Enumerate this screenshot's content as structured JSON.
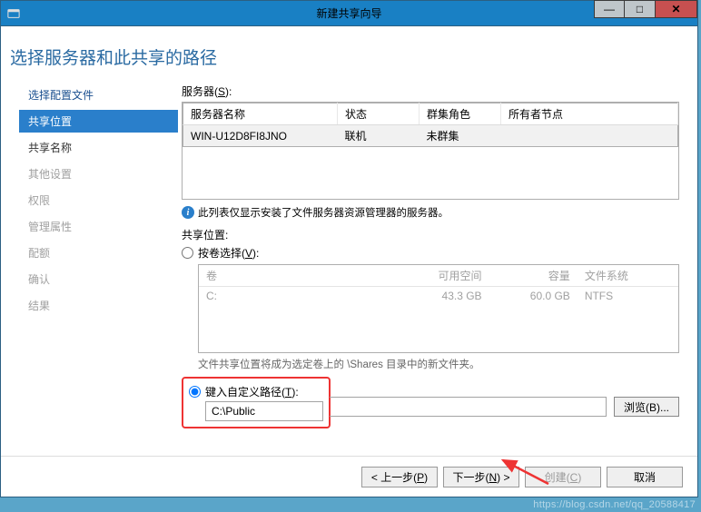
{
  "titlebar": {
    "title": "新建共享向导"
  },
  "page": {
    "heading": "选择服务器和此共享的路径"
  },
  "steps": {
    "s0": "选择配置文件",
    "s1": "共享位置",
    "s2": "共享名称",
    "s3": "其他设置",
    "s4": "权限",
    "s5": "管理属性",
    "s6": "配额",
    "s7": "确认",
    "s8": "结果"
  },
  "server": {
    "label": "服务器(S):",
    "headers": {
      "name": "服务器名称",
      "status": "状态",
      "role": "群集角色",
      "owner": "所有者节点"
    },
    "row": {
      "name": "WIN-U12D8FI8JNO",
      "status": "联机",
      "role": "未群集",
      "owner": ""
    },
    "info": "此列表仅显示安装了文件服务器资源管理器的服务器。"
  },
  "location": {
    "label": "共享位置:",
    "byVolume": "按卷选择(V):",
    "volHeaders": {
      "vol": "卷",
      "free": "可用空间",
      "cap": "容量",
      "fs": "文件系统"
    },
    "volRow": {
      "vol": "C:",
      "free": "43.3 GB",
      "cap": "60.0 GB",
      "fs": "NTFS"
    },
    "hint": "文件共享位置将成为选定卷上的 \\Shares 目录中的新文件夹。",
    "custom": "键入自定义路径(T):",
    "path": "C:\\Public",
    "browse": "浏览(B)..."
  },
  "footer": {
    "prev": "< 上一步(P)",
    "next": "下一步(N) >",
    "create": "创建(C)",
    "cancel": "取消"
  },
  "watermark": "https://blog.csdn.net/qq_20588417"
}
